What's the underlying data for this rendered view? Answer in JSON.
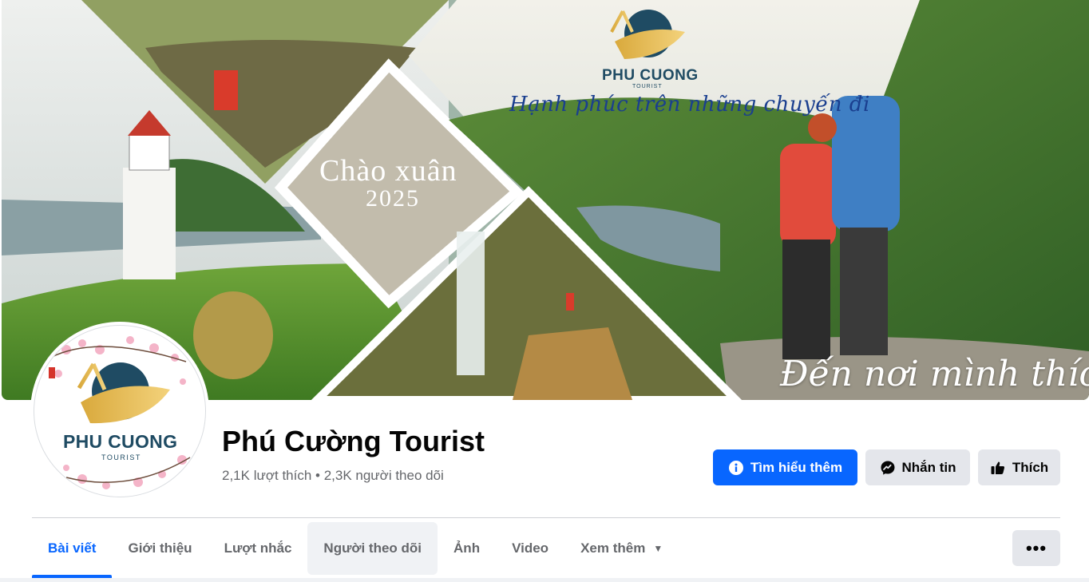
{
  "cover": {
    "brand_name": "PHU CUONG",
    "brand_sub": "TOURIST",
    "tagline": "Hạnh phúc trên những chuyến đi",
    "greeting_line1": "Chào xuân",
    "greeting_line2": "2025",
    "slogan": "Đến nơi mình thích"
  },
  "avatar": {
    "brand_name": "PHU CUONG",
    "brand_sub": "TOURIST"
  },
  "page": {
    "title": "Phú Cường Tourist",
    "stats": "2,1K lượt thích • 2,3K người theo dõi"
  },
  "actions": {
    "learn_more": "Tìm hiểu thêm",
    "message": "Nhắn tin",
    "like": "Thích"
  },
  "tabs": [
    {
      "label": "Bài viết",
      "active": true
    },
    {
      "label": "Giới thiệu"
    },
    {
      "label": "Lượt nhắc"
    },
    {
      "label": "Người theo dõi"
    },
    {
      "label": "Ảnh"
    },
    {
      "label": "Video"
    },
    {
      "label": "Xem thêm"
    }
  ],
  "more_label": "•••",
  "colors": {
    "accent": "#0866ff",
    "secondary_button": "#e4e6eb",
    "muted_text": "#65676b",
    "brand_navy": "#1f4b63"
  }
}
